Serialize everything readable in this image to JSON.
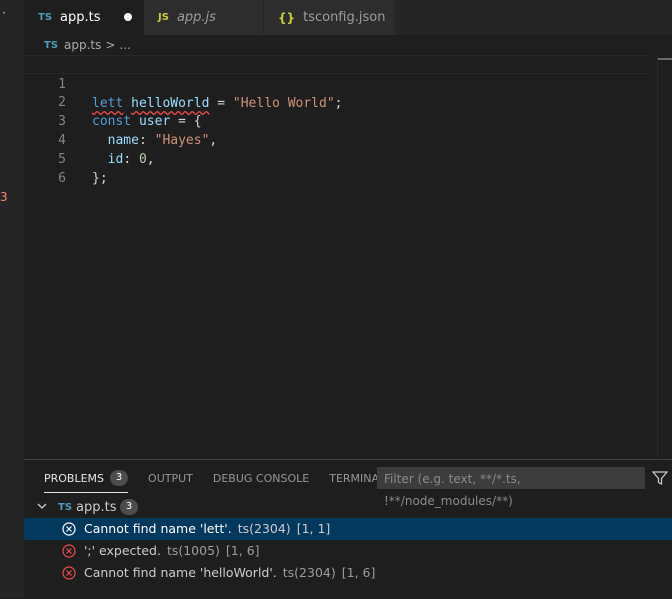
{
  "tabs": [
    {
      "icon": "TS",
      "label": "app.ts",
      "dirty": true
    },
    {
      "icon": "JS",
      "label": "app.js"
    },
    {
      "icon": "{}",
      "label": "tsconfig.json"
    }
  ],
  "breadcrumb": {
    "icon": "TS",
    "file": "app.ts",
    "sep": ">",
    "more": "..."
  },
  "left_strip": {
    "dot": "·",
    "count": "3"
  },
  "editor": {
    "line_numbers": [
      "1",
      "2",
      "3",
      "4",
      "5",
      "6"
    ],
    "line1": {
      "kw": "lett",
      "var": "helloWorld",
      "eq": " = ",
      "str": "\"Hello World\"",
      "end": ";"
    },
    "line2": {
      "kw": "const",
      "var": "user",
      "eq": " = {"
    },
    "line3": {
      "prop": "name",
      "colon": ": ",
      "str": "\"Hayes\"",
      "end": ","
    },
    "line4": {
      "prop": "id",
      "colon": ": ",
      "num": "0",
      "end": ","
    },
    "line5": {
      "text": "};"
    }
  },
  "panel": {
    "tabs": [
      {
        "label": "PROBLEMS",
        "badge": "3"
      },
      {
        "label": "OUTPUT"
      },
      {
        "label": "DEBUG CONSOLE"
      },
      {
        "label": "TERMINAL"
      }
    ],
    "filter_placeholder": "Filter (e.g. text, **/*.ts, !**/node_modules/**)",
    "group": {
      "icon": "TS",
      "file": "app.ts",
      "count": "3"
    },
    "problems": [
      {
        "message": "Cannot find name 'lett'.",
        "source": "ts(2304)",
        "pos": "[1, 1]"
      },
      {
        "message": "';' expected.",
        "source": "ts(1005)",
        "pos": "[1, 6]"
      },
      {
        "message": "Cannot find name 'helloWorld'.",
        "source": "ts(2304)",
        "pos": "[1, 6]"
      }
    ]
  },
  "colors": {
    "error": "#f14c4c",
    "selection": "#04395e",
    "ts_icon": "#519aba",
    "js_icon": "#cbcb41"
  }
}
